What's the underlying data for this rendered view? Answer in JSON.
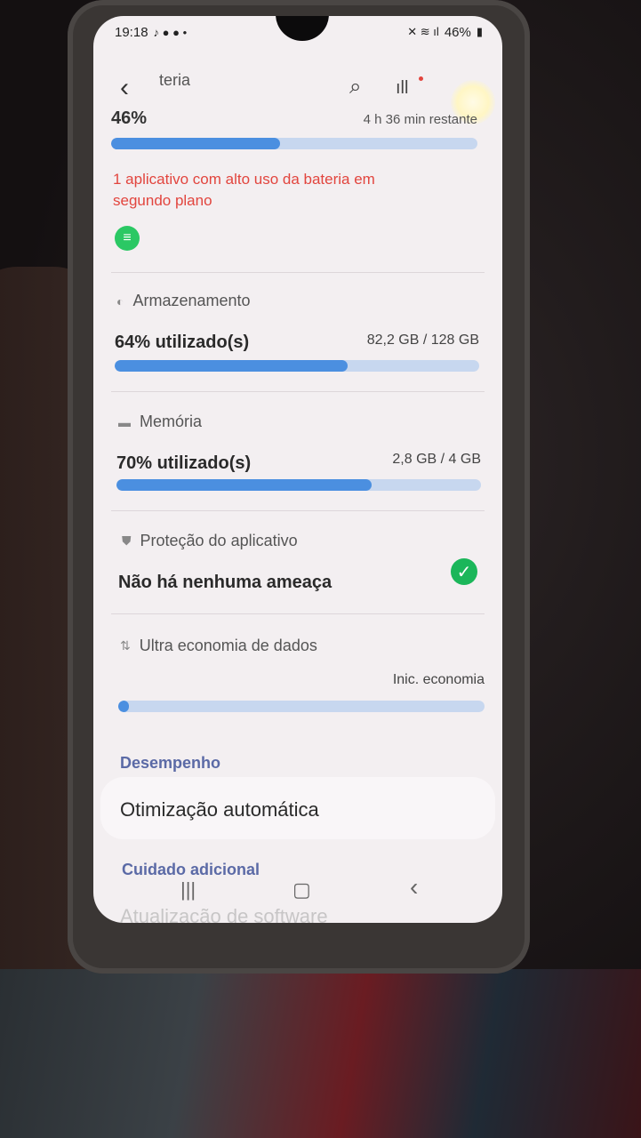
{
  "status_bar": {
    "time": "19:18",
    "apps": "♪ ● ● •",
    "battery": "46%"
  },
  "header": {
    "title": "teria"
  },
  "battery": {
    "percent_text": "46%",
    "remaining": "4 h 36 min restante",
    "level": 0.46,
    "warning": "1 aplicativo com alto uso da bateria em segundo plano"
  },
  "storage": {
    "title": "Armazenamento",
    "used_text": "64% utilizado(s)",
    "amount": "82,2 GB / 128 GB",
    "level": 0.64
  },
  "memory": {
    "title": "Memória",
    "used_text": "70% utilizado(s)",
    "amount": "2,8 GB / 4 GB",
    "level": 0.7
  },
  "protection": {
    "title": "Proteção do aplicativo",
    "status": "Não há nenhuma ameaça"
  },
  "data_saver": {
    "title": "Ultra economia de dados",
    "action": "Inic. economia",
    "level": 0.03
  },
  "sections": {
    "performance_label": "Desempenho",
    "auto_optimization": "Otimização automática",
    "extra_care_label": "Cuidado adicional",
    "software_update": "Atualização de software"
  },
  "colors": {
    "accent": "#4b8fe0",
    "warning": "#e2453e",
    "ok": "#1bb65a",
    "section": "#5b6aa6"
  }
}
